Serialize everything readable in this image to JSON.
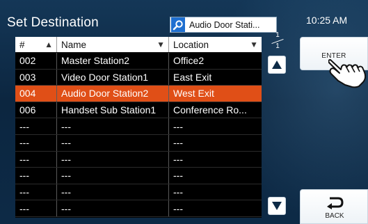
{
  "header": {
    "title": "Set Destination",
    "search_value": "Audio Door Stati...",
    "clock": "10:25 AM"
  },
  "table": {
    "columns": [
      {
        "label": "#",
        "sort_icon": "triangle-up"
      },
      {
        "label": "Name",
        "sort_icon": "triangle-down"
      },
      {
        "label": "Location",
        "sort_icon": "triangle-down"
      }
    ],
    "rows": [
      {
        "id": "002",
        "name": "Master Station2",
        "location": "Office2",
        "selected": false
      },
      {
        "id": "003",
        "name": "Video Door Station1",
        "location": "East Exit",
        "selected": false
      },
      {
        "id": "004",
        "name": "Audio Door Station2",
        "location": "West Exit",
        "selected": true
      },
      {
        "id": "006",
        "name": "Handset Sub Station1",
        "location": "Conference Ro...",
        "selected": false
      },
      {
        "id": "---",
        "name": "---",
        "location": "---",
        "selected": false
      },
      {
        "id": "---",
        "name": "---",
        "location": "---",
        "selected": false
      },
      {
        "id": "---",
        "name": "---",
        "location": "---",
        "selected": false
      },
      {
        "id": "---",
        "name": "---",
        "location": "---",
        "selected": false
      },
      {
        "id": "---",
        "name": "---",
        "location": "---",
        "selected": false
      },
      {
        "id": "---",
        "name": "---",
        "location": "---",
        "selected": false
      }
    ]
  },
  "pager": {
    "current": "1",
    "total": "1"
  },
  "buttons": {
    "enter_label": "ENTER",
    "back_label": "BACK"
  },
  "colors": {
    "selected_row": "#e04f17",
    "search_icon_bg": "#1f6fd0"
  }
}
